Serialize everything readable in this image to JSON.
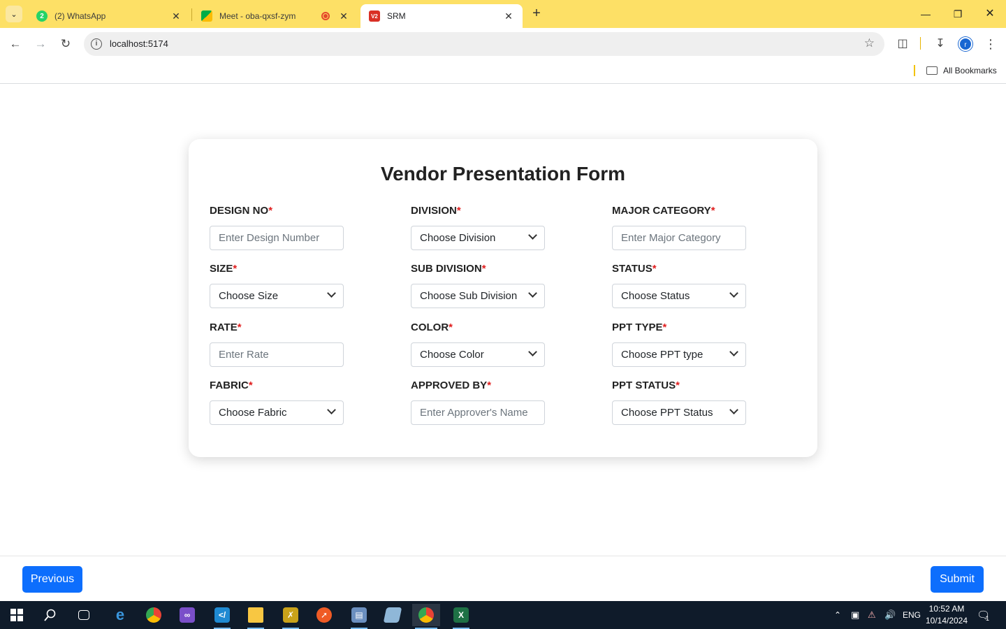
{
  "browser": {
    "tabs": [
      {
        "title": "(2) WhatsApp",
        "favicon_text": "2",
        "favicon_color": "#25d366"
      },
      {
        "title": "Meet - oba-qxsf-zym",
        "favicon_text": "",
        "favicon_color": "#00ac47"
      },
      {
        "title": "SRM",
        "favicon_text": "V2",
        "favicon_color": "#d93025"
      }
    ],
    "url": "localhost:5174",
    "bookmarks_label": "All Bookmarks",
    "profile_initial": "r",
    "accent_color": "#fde066"
  },
  "form": {
    "title": "Vendor Presentation Form",
    "required_marker": "*",
    "fields": [
      {
        "label": "DESIGN NO",
        "kind": "input",
        "placeholder": "Enter Design Number"
      },
      {
        "label": "DIVISION",
        "kind": "select",
        "value": "Choose Division"
      },
      {
        "label": "MAJOR CATEGORY",
        "kind": "input",
        "placeholder": "Enter Major Category"
      },
      {
        "label": "SIZE",
        "kind": "select",
        "value": "Choose Size"
      },
      {
        "label": "SUB DIVISION",
        "kind": "select",
        "value": "Choose Sub Division"
      },
      {
        "label": "STATUS",
        "kind": "select",
        "value": "Choose Status"
      },
      {
        "label": "RATE",
        "kind": "input",
        "placeholder": "Enter Rate"
      },
      {
        "label": "COLOR",
        "kind": "select",
        "value": "Choose Color"
      },
      {
        "label": "PPT TYPE",
        "kind": "select",
        "value": "Choose PPT type"
      },
      {
        "label": "FABRIC",
        "kind": "select",
        "value": "Choose Fabric"
      },
      {
        "label": "APPROVED BY",
        "kind": "input",
        "placeholder": "Enter Approver's Name"
      },
      {
        "label": "PPT STATUS",
        "kind": "select",
        "value": "Choose PPT Status"
      }
    ]
  },
  "footer": {
    "previous_label": "Previous",
    "submit_label": "Submit",
    "button_color": "#0d6efd"
  },
  "taskbar": {
    "language": "ENG",
    "time": "10:52 AM",
    "date": "10/14/2024",
    "notification_count": "1"
  }
}
